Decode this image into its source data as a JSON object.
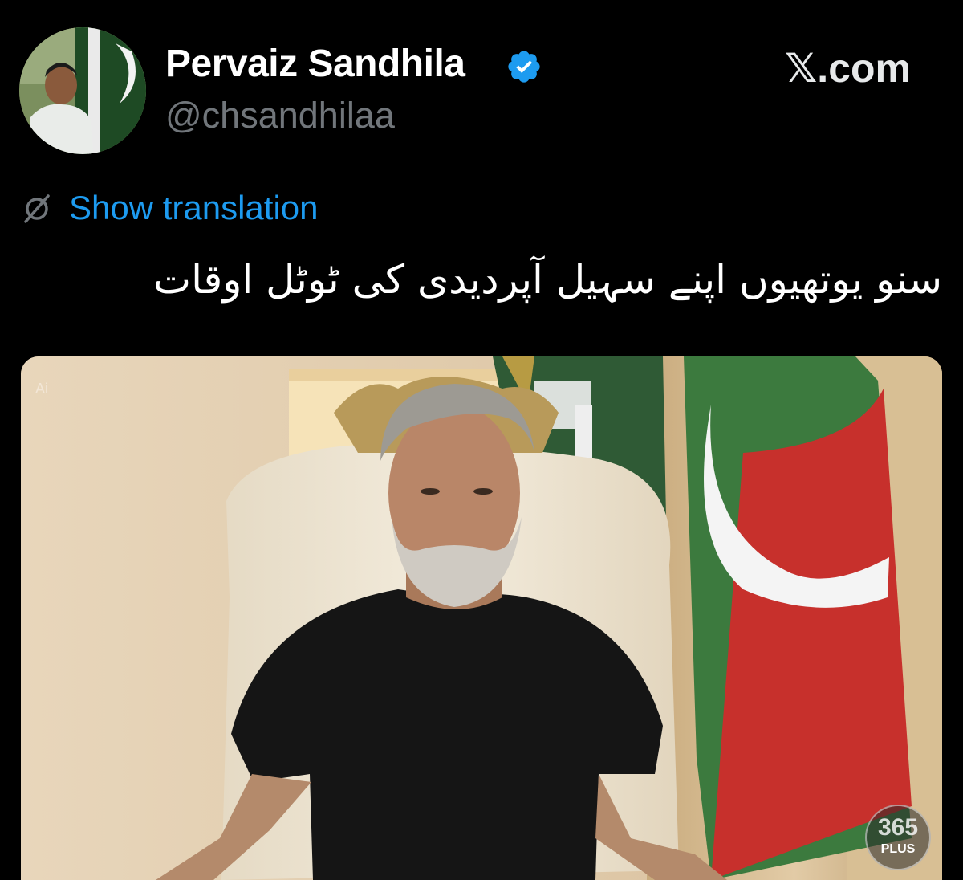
{
  "author": {
    "display_name": "Pervaiz Sandhila",
    "handle": "@chsandhilaa",
    "verified": true
  },
  "brand": {
    "site": ".com",
    "mark": "𝕏"
  },
  "translation": {
    "label": "Show translation"
  },
  "tweet": {
    "text": "سنو یوتھیوں اپنے سہیل آپردیدی کی ٹوٹل اوقات"
  },
  "media": {
    "ai_tag": "Ai",
    "watermark_number": "365",
    "watermark_label": "PLUS"
  },
  "icons": {
    "avatar": "profile-photo",
    "verified": "verified-badge-icon",
    "translate": "globe-slash-icon"
  },
  "colors": {
    "background": "#000000",
    "link": "#1d9bf0",
    "handle": "#71767b",
    "verified": "#1d9bf0"
  }
}
